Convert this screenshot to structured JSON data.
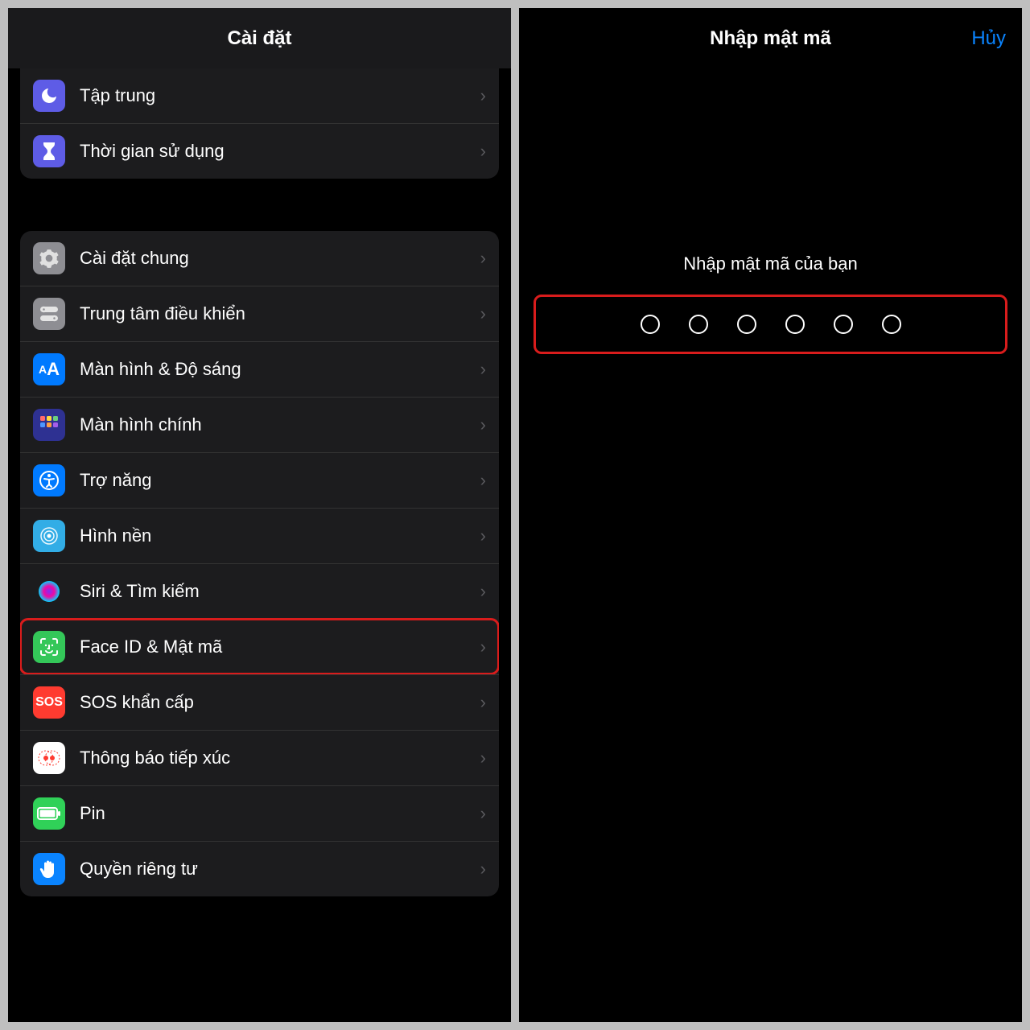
{
  "left": {
    "title": "Cài đặt",
    "section1": [
      {
        "label": "Tập trung",
        "icon": "moon-icon"
      },
      {
        "label": "Thời gian sử dụng",
        "icon": "hourglass-icon"
      }
    ],
    "section2": [
      {
        "label": "Cài đặt chung",
        "icon": "gear-icon"
      },
      {
        "label": "Trung tâm điều khiển",
        "icon": "switches-icon"
      },
      {
        "label": "Màn hình & Độ sáng",
        "icon": "text-size-icon"
      },
      {
        "label": "Màn hình chính",
        "icon": "home-screen-icon"
      },
      {
        "label": "Trợ năng",
        "icon": "accessibility-icon"
      },
      {
        "label": "Hình nền",
        "icon": "wallpaper-icon"
      },
      {
        "label": "Siri & Tìm kiếm",
        "icon": "siri-icon"
      },
      {
        "label": "Face ID & Mật mã",
        "icon": "faceid-icon",
        "highlight": true
      },
      {
        "label": "SOS khẩn cấp",
        "icon": "sos-icon"
      },
      {
        "label": "Thông báo tiếp xúc",
        "icon": "exposure-icon"
      },
      {
        "label": "Pin",
        "icon": "battery-icon"
      },
      {
        "label": "Quyền riêng tư",
        "icon": "hand-icon"
      }
    ]
  },
  "right": {
    "title": "Nhập mật mã",
    "cancel": "Hủy",
    "prompt": "Nhập mật mã của bạn",
    "dot_count": 6
  },
  "highlight_color": "#d91c1c"
}
